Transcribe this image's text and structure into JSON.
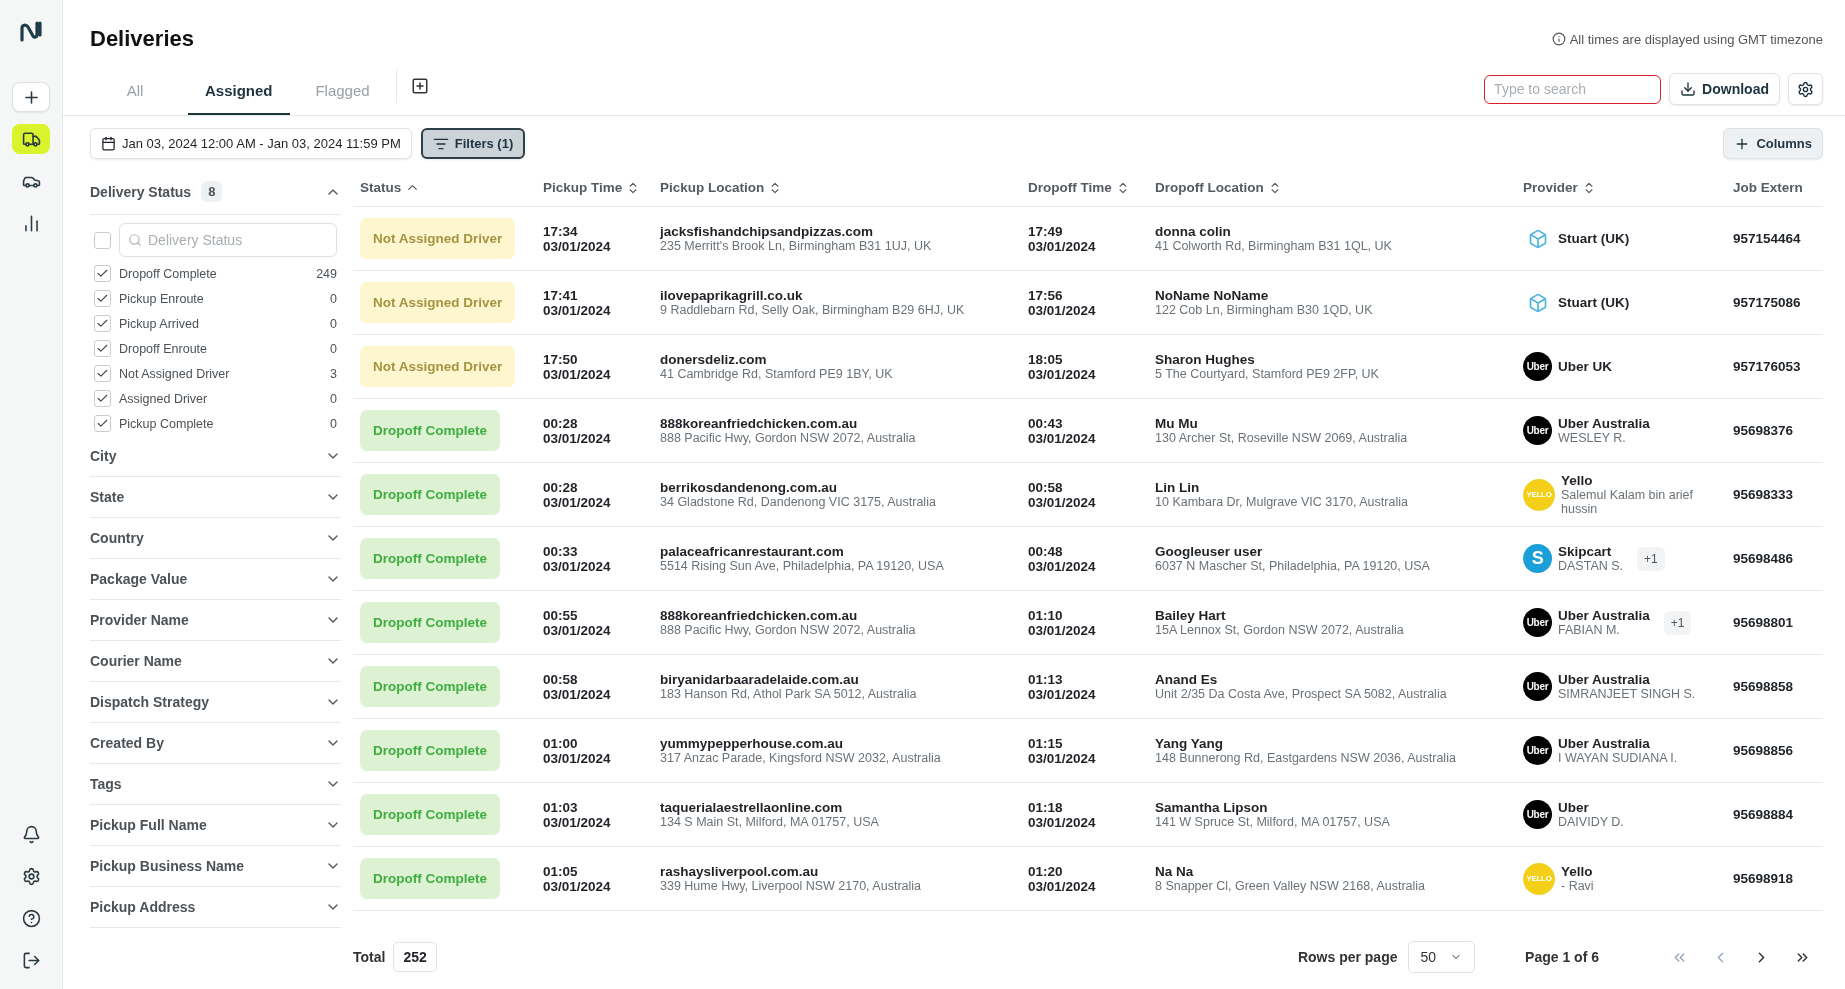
{
  "sidebar": {
    "items": [
      {
        "kind": "add",
        "selected": false
      },
      {
        "kind": "truck",
        "selected": true
      },
      {
        "kind": "car",
        "selected": false
      },
      {
        "kind": "chart",
        "selected": false
      }
    ],
    "bottom_items": [
      {
        "kind": "bell"
      },
      {
        "kind": "settings"
      },
      {
        "kind": "help"
      },
      {
        "kind": "logout"
      }
    ]
  },
  "page": {
    "title": "Deliveries",
    "timezone_note": "All times are displayed using GMT timezone"
  },
  "tabs": [
    {
      "label": "All",
      "selected": false
    },
    {
      "label": "Assigned",
      "selected": true
    },
    {
      "label": "Flagged",
      "selected": false
    }
  ],
  "search": {
    "placeholder": "Type to search"
  },
  "download_button": "Download",
  "date_range": "Jan 03, 2024 12:00 AM - Jan 03, 2024 11:59 PM",
  "filters_button": "Filters (1)",
  "columns_button": "Columns",
  "filters": [
    {
      "title": "Delivery Status",
      "count": "8",
      "expanded": true,
      "search_placeholder": "Delivery Status",
      "select_all_checked": false,
      "options": [
        {
          "label": "Dropoff Complete",
          "count": "249",
          "checked": true
        },
        {
          "label": "Pickup Enroute",
          "count": "0",
          "checked": true
        },
        {
          "label": "Pickup Arrived",
          "count": "0",
          "checked": true
        },
        {
          "label": "Dropoff Enroute",
          "count": "0",
          "checked": true
        },
        {
          "label": "Not Assigned Driver",
          "count": "3",
          "checked": true
        },
        {
          "label": "Assigned Driver",
          "count": "0",
          "checked": true
        },
        {
          "label": "Pickup Complete",
          "count": "0",
          "checked": true
        }
      ]
    },
    {
      "title": "City",
      "expanded": false
    },
    {
      "title": "State",
      "expanded": false
    },
    {
      "title": "Country",
      "expanded": false
    },
    {
      "title": "Package Value",
      "expanded": false
    },
    {
      "title": "Provider Name",
      "expanded": false
    },
    {
      "title": "Courier Name",
      "expanded": false
    },
    {
      "title": "Dispatch Strategy",
      "expanded": false
    },
    {
      "title": "Created By",
      "expanded": false
    },
    {
      "title": "Tags",
      "expanded": false
    },
    {
      "title": "Pickup Full Name",
      "expanded": false
    },
    {
      "title": "Pickup Business Name",
      "expanded": false
    },
    {
      "title": "Pickup Address",
      "expanded": false
    }
  ],
  "table": {
    "columns": [
      {
        "label": "Status",
        "kind": "sorted"
      },
      {
        "label": "Pickup Time",
        "kind": "sortable"
      },
      {
        "label": "Pickup Location",
        "kind": "sortable"
      },
      {
        "label": "Dropoff Time",
        "kind": "sortable"
      },
      {
        "label": "Dropoff Location",
        "kind": "sortable"
      },
      {
        "label": "Provider",
        "kind": "sortable"
      },
      {
        "label": "Job Extern",
        "kind": "plain"
      }
    ],
    "rows": [
      {
        "status": {
          "kind": "pending",
          "label": "Not Assigned Driver"
        },
        "pickup_time": "17:34",
        "pickup_date": "03/01/2024",
        "pickup_name": "jacksfishandchipsandpizzas.com",
        "pickup_address": "235 Merritt's Brook Ln, Birmingham B31 1UJ, UK",
        "dropoff_time": "17:49",
        "dropoff_date": "03/01/2024",
        "dropoff_name": "donna colin",
        "dropoff_address": "41 Colworth Rd, Birmingham B31 1QL, UK",
        "provider": {
          "kind": "stuart",
          "name": "Stuart (UK)"
        },
        "job": "957154464"
      },
      {
        "status": {
          "kind": "pending",
          "label": "Not Assigned Driver"
        },
        "pickup_time": "17:41",
        "pickup_date": "03/01/2024",
        "pickup_name": "ilovepaprikagrill.co.uk",
        "pickup_address": "9 Raddlebarn Rd, Selly Oak, Birmingham B29 6HJ, UK",
        "dropoff_time": "17:56",
        "dropoff_date": "03/01/2024",
        "dropoff_name": "NoName NoName",
        "dropoff_address": "122 Cob Ln, Birmingham B30 1QD, UK",
        "provider": {
          "kind": "stuart",
          "name": "Stuart (UK)"
        },
        "job": "957175086"
      },
      {
        "status": {
          "kind": "pending",
          "label": "Not Assigned Driver"
        },
        "pickup_time": "17:50",
        "pickup_date": "03/01/2024",
        "pickup_name": "donersdeliz.com",
        "pickup_address": "41 Cambridge Rd, Stamford PE9 1BY, UK",
        "dropoff_time": "18:05",
        "dropoff_date": "03/01/2024",
        "dropoff_name": "Sharon Hughes",
        "dropoff_address": "5 The Courtyard, Stamford PE9 2FP, UK",
        "provider": {
          "kind": "uber",
          "logo_text": "Uber",
          "name": "Uber UK"
        },
        "job": "957176053"
      },
      {
        "status": {
          "kind": "complete",
          "label": "Dropoff Complete"
        },
        "pickup_time": "00:28",
        "pickup_date": "03/01/2024",
        "pickup_name": "888koreanfriedchicken.com.au",
        "pickup_address": "888 Pacific Hwy, Gordon NSW 2072, Australia",
        "dropoff_time": "00:43",
        "dropoff_date": "03/01/2024",
        "dropoff_name": "Mu Mu",
        "dropoff_address": "130 Archer St, Roseville NSW 2069, Australia",
        "provider": {
          "kind": "uber",
          "logo_text": "Uber",
          "name": "Uber Australia",
          "courier": "WESLEY R."
        },
        "job": "95698376"
      },
      {
        "status": {
          "kind": "complete",
          "label": "Dropoff Complete"
        },
        "pickup_time": "00:28",
        "pickup_date": "03/01/2024",
        "pickup_name": "berrikosdandenong.com.au",
        "pickup_address": "34 Gladstone Rd, Dandenong VIC 3175, Australia",
        "dropoff_time": "00:58",
        "dropoff_date": "03/01/2024",
        "dropoff_name": "Lin Lin",
        "dropoff_address": "10 Kambara Dr, Mulgrave VIC 3170, Australia",
        "provider": {
          "kind": "yello",
          "logo_text": "YELLO",
          "name": "Yello",
          "courier": "Salemul Kalam bin arief hussin"
        },
        "job": "95698333"
      },
      {
        "status": {
          "kind": "complete",
          "label": "Dropoff Complete"
        },
        "pickup_time": "00:33",
        "pickup_date": "03/01/2024",
        "pickup_name": "palaceafricanrestaurant.com",
        "pickup_address": "5514 Rising Sun Ave, Philadelphia, PA 19120, USA",
        "dropoff_time": "00:48",
        "dropoff_date": "03/01/2024",
        "dropoff_name": "Googleuser user",
        "dropoff_address": "6037 N Mascher St, Philadelphia, PA 19120, USA",
        "provider": {
          "kind": "skipcart",
          "logo_text": "S",
          "name": "Skipcart",
          "courier": "DASTAN S.",
          "extra": "+1"
        },
        "job": "95698486"
      },
      {
        "status": {
          "kind": "complete",
          "label": "Dropoff Complete"
        },
        "pickup_time": "00:55",
        "pickup_date": "03/01/2024",
        "pickup_name": "888koreanfriedchicken.com.au",
        "pickup_address": "888 Pacific Hwy, Gordon NSW 2072, Australia",
        "dropoff_time": "01:10",
        "dropoff_date": "03/01/2024",
        "dropoff_name": "Bailey Hart",
        "dropoff_address": "15A Lennox St, Gordon NSW 2072, Australia",
        "provider": {
          "kind": "uber",
          "logo_text": "Uber",
          "name": "Uber Australia",
          "courier": "FABIAN M.",
          "extra": "+1"
        },
        "job": "95698801"
      },
      {
        "status": {
          "kind": "complete",
          "label": "Dropoff Complete"
        },
        "pickup_time": "00:58",
        "pickup_date": "03/01/2024",
        "pickup_name": "biryanidarbaaradelaide.com.au",
        "pickup_address": "183 Hanson Rd, Athol Park SA 5012, Australia",
        "dropoff_time": "01:13",
        "dropoff_date": "03/01/2024",
        "dropoff_name": "Anand Es",
        "dropoff_address": "Unit 2/35 Da Costa Ave, Prospect SA 5082, Australia",
        "provider": {
          "kind": "uber",
          "logo_text": "Uber",
          "name": "Uber Australia",
          "courier": "SIMRANJEET SINGH S."
        },
        "job": "95698858"
      },
      {
        "status": {
          "kind": "complete",
          "label": "Dropoff Complete"
        },
        "pickup_time": "01:00",
        "pickup_date": "03/01/2024",
        "pickup_name": "yummypepperhouse.com.au",
        "pickup_address": "317 Anzac Parade, Kingsford NSW 2032, Australia",
        "dropoff_time": "01:15",
        "dropoff_date": "03/01/2024",
        "dropoff_name": "Yang Yang",
        "dropoff_address": "148 Bunnerong Rd, Eastgardens NSW 2036, Australia",
        "provider": {
          "kind": "uber",
          "logo_text": "Uber",
          "name": "Uber Australia",
          "courier": "I WAYAN SUDIANA I."
        },
        "job": "95698856"
      },
      {
        "status": {
          "kind": "complete",
          "label": "Dropoff Complete"
        },
        "pickup_time": "01:03",
        "pickup_date": "03/01/2024",
        "pickup_name": "taquerialaestrellaonline.com",
        "pickup_address": "134 S Main St, Milford, MA 01757, USA",
        "dropoff_time": "01:18",
        "dropoff_date": "03/01/2024",
        "dropoff_name": "Samantha Lipson",
        "dropoff_address": "141 W Spruce St, Milford, MA 01757, USA",
        "provider": {
          "kind": "uber",
          "logo_text": "Uber",
          "name": "Uber",
          "courier": "DAIVIDY D."
        },
        "job": "95698884"
      },
      {
        "status": {
          "kind": "complete",
          "label": "Dropoff Complete"
        },
        "pickup_time": "01:05",
        "pickup_date": "03/01/2024",
        "pickup_name": "rashaysliverpool.com.au",
        "pickup_address": "339 Hume Hwy, Liverpool NSW 2170, Australia",
        "dropoff_time": "01:20",
        "dropoff_date": "03/01/2024",
        "dropoff_name": "Na Na",
        "dropoff_address": "8 Snapper Cl, Green Valley NSW 2168, Australia",
        "provider": {
          "kind": "yello",
          "logo_text": "YELLO",
          "name": "Yello",
          "courier": "- Ravi"
        },
        "job": "95698918"
      }
    ]
  },
  "footer": {
    "total_label": "Total",
    "total": "252",
    "rows_per_page_label": "Rows per page",
    "rows_per_page": "50",
    "page": "Page 1 of 6"
  }
}
